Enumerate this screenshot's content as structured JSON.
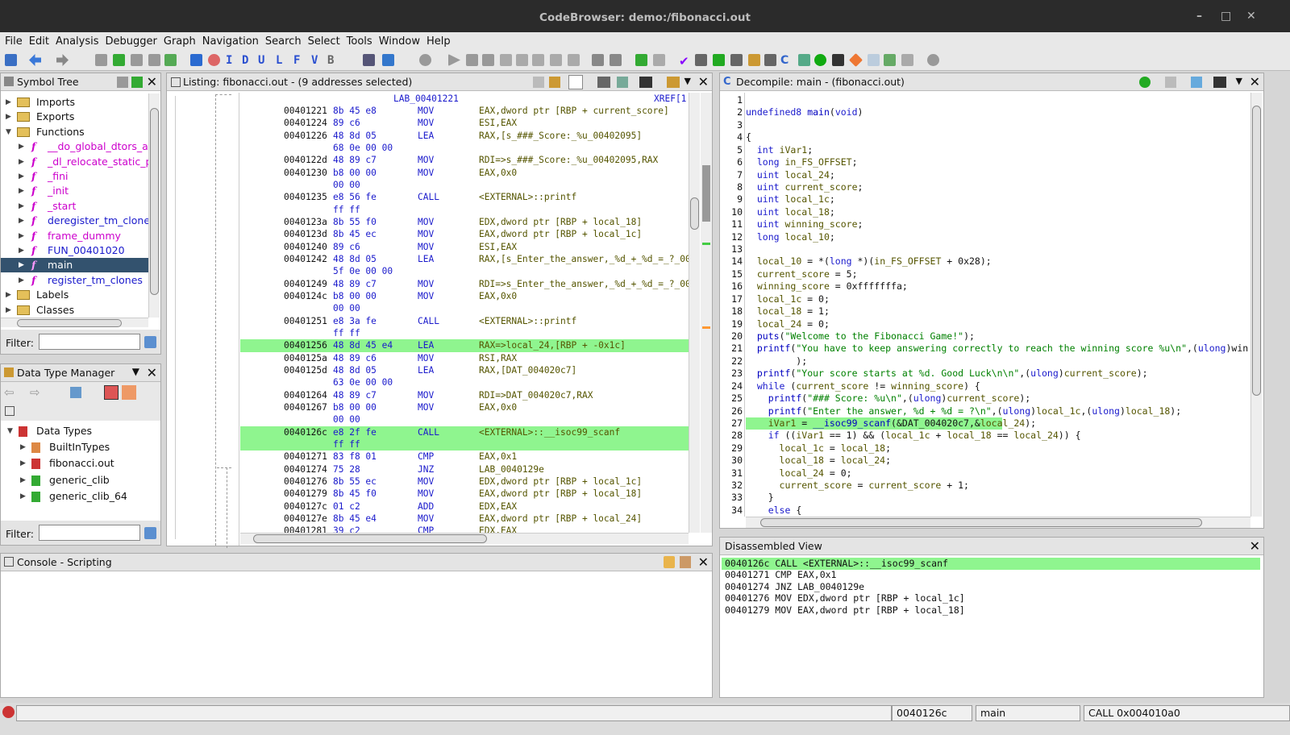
{
  "window": {
    "title": "CodeBrowser: demo:/fibonacci.out",
    "minimize": "–",
    "maximize": "□",
    "close": "✕"
  },
  "menu": [
    "File",
    "Edit",
    "Analysis",
    "Debugger",
    "Graph",
    "Navigation",
    "Search",
    "Select",
    "Tools",
    "Window",
    "Help"
  ],
  "symbol_tree": {
    "title": "Symbol Tree",
    "items": [
      {
        "label": "Imports",
        "indent": 0,
        "kind": "folder"
      },
      {
        "label": "Exports",
        "indent": 0,
        "kind": "folder"
      },
      {
        "label": "Functions",
        "indent": 0,
        "kind": "folder-open"
      },
      {
        "label": "__do_global_dtors_au",
        "indent": 1,
        "kind": "func"
      },
      {
        "label": "_dl_relocate_static_p",
        "indent": 1,
        "kind": "func"
      },
      {
        "label": "_fini",
        "indent": 1,
        "kind": "func"
      },
      {
        "label": "_init",
        "indent": 1,
        "kind": "func"
      },
      {
        "label": "_start",
        "indent": 1,
        "kind": "func"
      },
      {
        "label": "deregister_tm_clone",
        "indent": 1,
        "kind": "func-blue"
      },
      {
        "label": "frame_dummy",
        "indent": 1,
        "kind": "func"
      },
      {
        "label": "FUN_00401020",
        "indent": 1,
        "kind": "func-blue"
      },
      {
        "label": "main",
        "indent": 1,
        "kind": "func-selected"
      },
      {
        "label": "register_tm_clones",
        "indent": 1,
        "kind": "func-blue"
      },
      {
        "label": "Labels",
        "indent": 0,
        "kind": "folder"
      },
      {
        "label": "Classes",
        "indent": 0,
        "kind": "folder"
      }
    ],
    "filter_label": "Filter:"
  },
  "data_type_manager": {
    "title": "Data Type Manager",
    "items": [
      {
        "label": "Data Types",
        "indent": 0
      },
      {
        "label": "BuiltInTypes",
        "indent": 1
      },
      {
        "label": "fibonacci.out",
        "indent": 1
      },
      {
        "label": "generic_clib",
        "indent": 1
      },
      {
        "label": "generic_clib_64",
        "indent": 1
      }
    ],
    "filter_label": "Filter:"
  },
  "listing": {
    "title": "Listing:  fibonacci.out - (9 addresses selected)",
    "header_label": "LAB_00401221",
    "xref": "XREF[1",
    "rows": [
      {
        "addr": "00401221",
        "bytes": "8b 45 e8",
        "mn": "MOV",
        "op": "EAX,dword ptr [RBP + current_score]",
        "hl": false
      },
      {
        "addr": "00401224",
        "bytes": "89 c6",
        "mn": "MOV",
        "op": "ESI,EAX",
        "hl": false
      },
      {
        "addr": "00401226",
        "bytes": "48 8d 05",
        "mn": "LEA",
        "op": "RAX,[s_###_Score:_%u_00402095]",
        "hl": false
      },
      {
        "addr": "",
        "bytes": "68 0e 00 00",
        "mn": "",
        "op": "",
        "hl": false
      },
      {
        "addr": "0040122d",
        "bytes": "48 89 c7",
        "mn": "MOV",
        "op": "RDI=>s_###_Score:_%u_00402095,RAX",
        "hl": false
      },
      {
        "addr": "00401230",
        "bytes": "b8 00 00",
        "mn": "MOV",
        "op": "EAX,0x0",
        "hl": false
      },
      {
        "addr": "",
        "bytes": "00 00",
        "mn": "",
        "op": "",
        "hl": false
      },
      {
        "addr": "00401235",
        "bytes": "e8 56 fe",
        "mn": "CALL",
        "op": "<EXTERNAL>::printf",
        "hl": false
      },
      {
        "addr": "",
        "bytes": "ff ff",
        "mn": "",
        "op": "",
        "hl": false
      },
      {
        "addr": "0040123a",
        "bytes": "8b 55 f0",
        "mn": "MOV",
        "op": "EDX,dword ptr [RBP + local_18]",
        "hl": false
      },
      {
        "addr": "0040123d",
        "bytes": "8b 45 ec",
        "mn": "MOV",
        "op": "EAX,dword ptr [RBP + local_1c]",
        "hl": false
      },
      {
        "addr": "00401240",
        "bytes": "89 c6",
        "mn": "MOV",
        "op": "ESI,EAX",
        "hl": false
      },
      {
        "addr": "00401242",
        "bytes": "48 8d 05",
        "mn": "LEA",
        "op": "RAX,[s_Enter_the_answer,_%d_+_%d_=_?_00",
        "hl": false
      },
      {
        "addr": "",
        "bytes": "5f 0e 00 00",
        "mn": "",
        "op": "",
        "hl": false
      },
      {
        "addr": "00401249",
        "bytes": "48 89 c7",
        "mn": "MOV",
        "op": "RDI=>s_Enter_the_answer,_%d_+_%d_=_?_00",
        "hl": false
      },
      {
        "addr": "0040124c",
        "bytes": "b8 00 00",
        "mn": "MOV",
        "op": "EAX,0x0",
        "hl": false
      },
      {
        "addr": "",
        "bytes": "00 00",
        "mn": "",
        "op": "",
        "hl": false
      },
      {
        "addr": "00401251",
        "bytes": "e8 3a fe",
        "mn": "CALL",
        "op": "<EXTERNAL>::printf",
        "hl": false
      },
      {
        "addr": "",
        "bytes": "ff ff",
        "mn": "",
        "op": "",
        "hl": false
      },
      {
        "addr": "00401256",
        "bytes": "48 8d 45 e4",
        "mn": "LEA",
        "op": "RAX=>local_24,[RBP + -0x1c]",
        "hl": true
      },
      {
        "addr": "0040125a",
        "bytes": "48 89 c6",
        "mn": "MOV",
        "op": "RSI,RAX",
        "hl": false
      },
      {
        "addr": "0040125d",
        "bytes": "48 8d 05",
        "mn": "LEA",
        "op": "RAX,[DAT_004020c7]",
        "hl": false
      },
      {
        "addr": "",
        "bytes": "63 0e 00 00",
        "mn": "",
        "op": "",
        "hl": false
      },
      {
        "addr": "00401264",
        "bytes": "48 89 c7",
        "mn": "MOV",
        "op": "RDI=>DAT_004020c7,RAX",
        "hl": false
      },
      {
        "addr": "00401267",
        "bytes": "b8 00 00",
        "mn": "MOV",
        "op": "EAX,0x0",
        "hl": false
      },
      {
        "addr": "",
        "bytes": "00 00",
        "mn": "",
        "op": "",
        "hl": false
      },
      {
        "addr": "0040126c",
        "bytes": "e8 2f fe",
        "mn": "CALL",
        "op": "<EXTERNAL>::__isoc99_scanf",
        "hl": true
      },
      {
        "addr": "",
        "bytes": "ff ff",
        "mn": "",
        "op": "",
        "hl": true
      },
      {
        "addr": "00401271",
        "bytes": "83 f8 01",
        "mn": "CMP",
        "op": "EAX,0x1",
        "hl": false
      },
      {
        "addr": "00401274",
        "bytes": "75 28",
        "mn": "JNZ",
        "op": "LAB_0040129e",
        "hl": false
      },
      {
        "addr": "00401276",
        "bytes": "8b 55 ec",
        "mn": "MOV",
        "op": "EDX,dword ptr [RBP + local_1c]",
        "hl": false
      },
      {
        "addr": "00401279",
        "bytes": "8b 45 f0",
        "mn": "MOV",
        "op": "EAX,dword ptr [RBP + local_18]",
        "hl": false
      },
      {
        "addr": "0040127c",
        "bytes": "01 c2",
        "mn": "ADD",
        "op": "EDX,EAX",
        "hl": false
      },
      {
        "addr": "0040127e",
        "bytes": "8b 45 e4",
        "mn": "MOV",
        "op": "EAX,dword ptr [RBP + local_24]",
        "hl": false
      },
      {
        "addr": "00401281",
        "bytes": "39 c2",
        "mn": "CMP",
        "op": "EDX,EAX",
        "hl": false
      }
    ]
  },
  "decompile": {
    "title": "Decompile: main -  (fibonacci.out)",
    "lines": [
      "",
      "undefined8 main(void)",
      "",
      "{",
      "  int iVar1;",
      "  long in_FS_OFFSET;",
      "  uint local_24;",
      "  uint current_score;",
      "  uint local_1c;",
      "  uint local_18;",
      "  uint winning_score;",
      "  long local_10;",
      "",
      "  local_10 = *(long *)(in_FS_OFFSET + 0x28);",
      "  current_score = 5;",
      "  winning_score = 0xfffffffa;",
      "  local_1c = 0;",
      "  local_18 = 1;",
      "  local_24 = 0;",
      "  puts(\"Welcome to the Fibonacci Game!\");",
      "  printf(\"You have to keep answering correctly to reach the winning score %u\\n\",(ulong)winnin",
      "         );",
      "  printf(\"Your score starts at %d. Good Luck\\n\\n\",(ulong)current_score);",
      "  while (current_score != winning_score) {",
      "    printf(\"### Score: %u\\n\",(ulong)current_score);",
      "    printf(\"Enter the answer, %d + %d = ?\\n\",(ulong)local_1c,(ulong)local_18);",
      "    iVar1 = __isoc99_scanf(&DAT_004020c7,&local_24);",
      "    if ((iVar1 == 1) && (local_1c + local_18 == local_24)) {",
      "      local_1c = local_18;",
      "      local_18 = local_24;",
      "      local_24 = 0;",
      "      current_score = current_score + 1;",
      "    }",
      "    else {"
    ],
    "highlight_line": 27
  },
  "disassembled_view": {
    "title": "Disassembled View",
    "lines": [
      "0040126c CALL <EXTERNAL>::__isoc99_scanf",
      "00401271 CMP EAX,0x1",
      "00401274 JNZ LAB_0040129e",
      "00401276 MOV EDX,dword ptr [RBP + local_1c]",
      "00401279 MOV EAX,dword ptr [RBP + local_18]"
    ]
  },
  "console": {
    "title": "Console - Scripting"
  },
  "status": {
    "address": "0040126c",
    "function": "main",
    "instruction": "CALL 0x004010a0"
  }
}
